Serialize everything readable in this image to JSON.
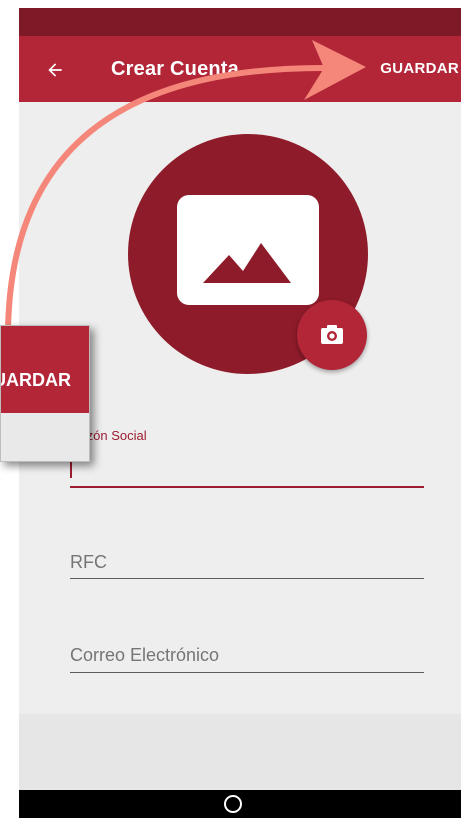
{
  "app_bar": {
    "back_icon": "arrow-back-icon",
    "title": "Crear Cuenta",
    "save_label": "GUARDAR"
  },
  "profile": {
    "avatar_icon": "image-placeholder-icon",
    "camera_icon": "camera-icon"
  },
  "form": {
    "razon_social_label": "Razón Social",
    "rfc_placeholder": "RFC",
    "email_placeholder": "Correo Electrónico"
  },
  "zoom_callout": {
    "text": "GUARDAR"
  },
  "colors": {
    "primary": "#b22638",
    "primary_dark": "#7e1a28",
    "avatar": "#8e1b2a",
    "arrow": "#f4877a"
  }
}
